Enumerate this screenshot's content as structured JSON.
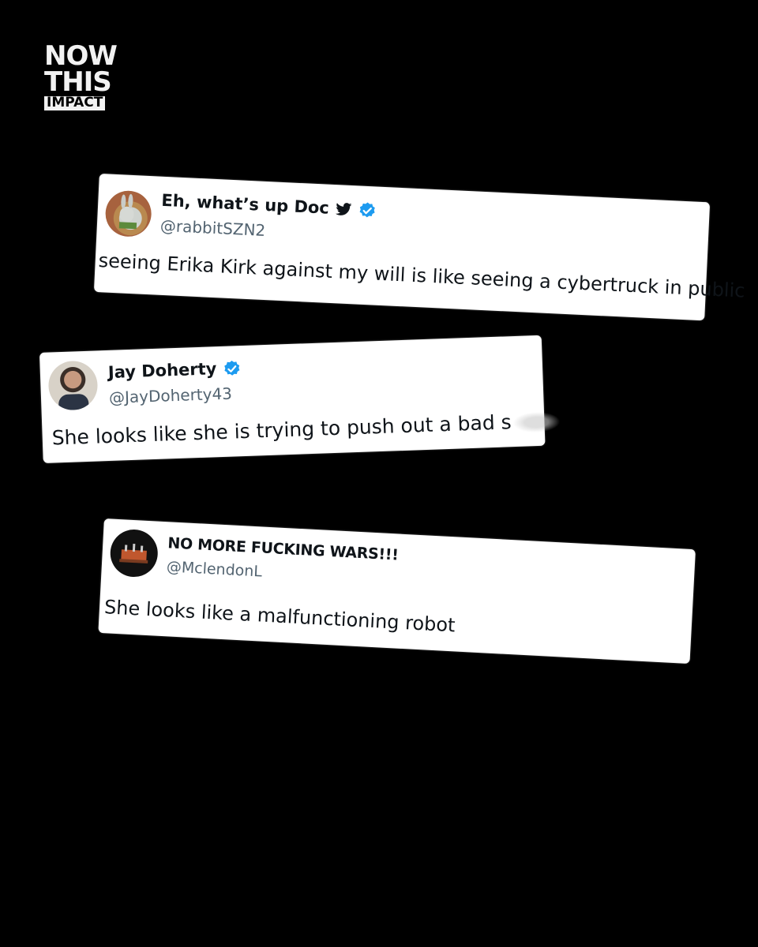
{
  "brand": {
    "line1": "NOW",
    "line2": "THIS",
    "line3": "IMPACT"
  },
  "tweets": [
    {
      "name": "Eh, what’s up Doc",
      "handle": "@rabbitSZN2",
      "text": "seeing Erika Kirk against my will is like seeing a cybertruck in public",
      "verified": true,
      "bird_icon": true
    },
    {
      "name": "Jay Doherty",
      "handle": "@JayDoherty43",
      "text": "She looks like she is trying to push out a bad s",
      "verified": true
    },
    {
      "name": "NO MORE FUCKING WARS!!!",
      "handle": "@MclendonL",
      "text": "She looks like a malfunctioning robot",
      "verified": false
    }
  ],
  "colors": {
    "background": "#000000",
    "card": "#ffffff",
    "verified": "#1d9bf0",
    "handle": "#536471"
  }
}
